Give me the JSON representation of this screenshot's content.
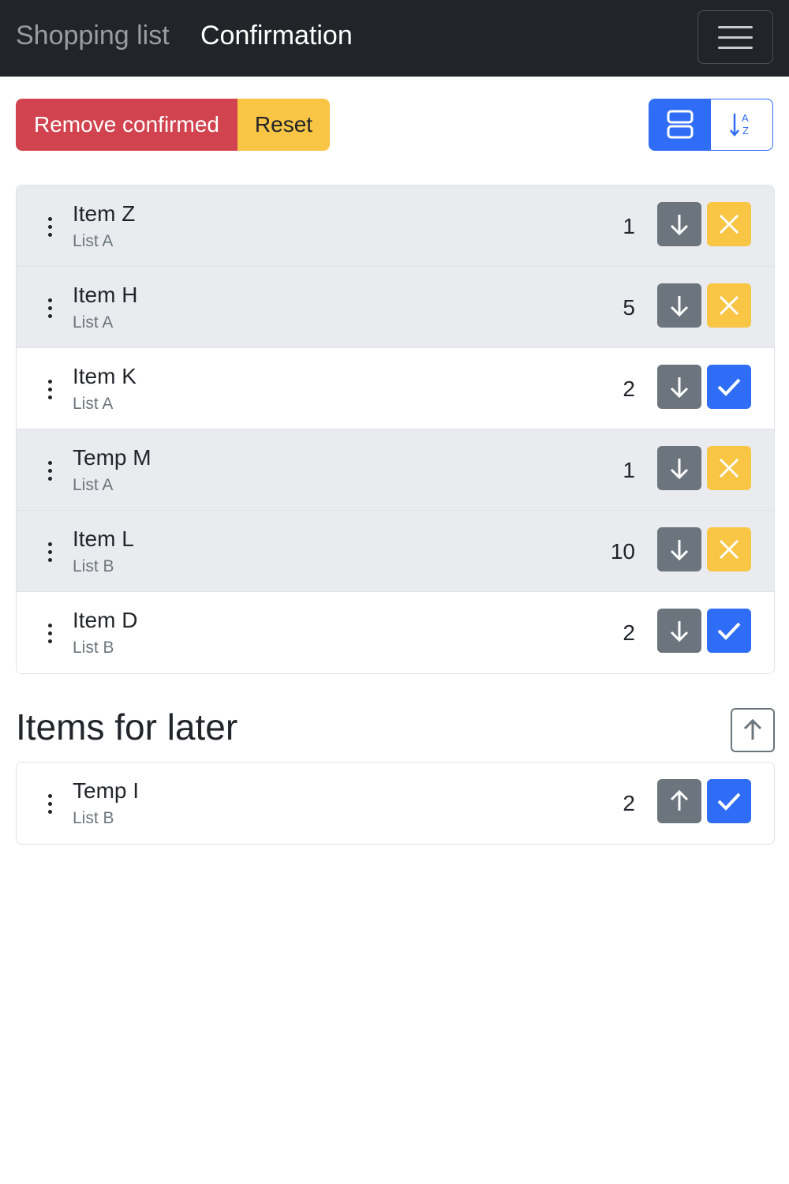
{
  "navbar": {
    "brand": "Shopping list",
    "title": "Confirmation"
  },
  "toolbar": {
    "remove_label": "Remove confirmed",
    "reset_label": "Reset"
  },
  "items": [
    {
      "name": "Item Z",
      "list": "List A",
      "qty": "1",
      "state": "unconfirmed"
    },
    {
      "name": "Item H",
      "list": "List A",
      "qty": "5",
      "state": "unconfirmed"
    },
    {
      "name": "Item K",
      "list": "List A",
      "qty": "2",
      "state": "confirmed"
    },
    {
      "name": "Temp M",
      "list": "List A",
      "qty": "1",
      "state": "unconfirmed"
    },
    {
      "name": "Item L",
      "list": "List B",
      "qty": "10",
      "state": "unconfirmed"
    },
    {
      "name": "Item D",
      "list": "List B",
      "qty": "2",
      "state": "confirmed"
    }
  ],
  "later": {
    "title": "Items for later",
    "items": [
      {
        "name": "Temp I",
        "list": "List B",
        "qty": "2",
        "state": "confirmed"
      }
    ]
  },
  "colors": {
    "primary": "#2f6df6",
    "danger": "#d1434e",
    "warning": "#f8c545",
    "secondary": "#6c757d",
    "navbar": "#212529"
  }
}
